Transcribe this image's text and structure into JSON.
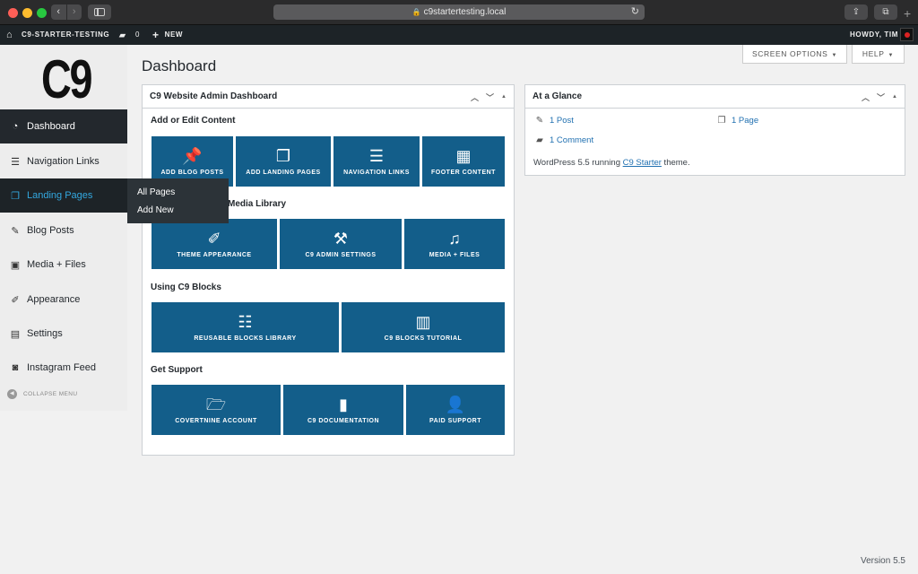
{
  "browser": {
    "url": "c9startertesting.local",
    "nav_back": "‹",
    "nav_forward": "›",
    "reload": "↻",
    "share": "⇪",
    "tabs": "⧉",
    "new_tab": "+"
  },
  "adminbar": {
    "home_icon": "⌂",
    "site_name": "C9-STARTER-TESTING",
    "comments_icon": "▰",
    "comment_count": "0",
    "new_icon": "+",
    "new_label": "NEW",
    "howdy": "HOWDY, TIM"
  },
  "sidebar": {
    "logo": "C9",
    "items": [
      {
        "label": "Dashboard",
        "icon": "◔"
      },
      {
        "label": "Navigation Links",
        "icon": "☰"
      },
      {
        "label": "Landing Pages",
        "icon": "❐"
      },
      {
        "label": "Blog Posts",
        "icon": "✎"
      },
      {
        "label": "Media + Files",
        "icon": "▣"
      },
      {
        "label": "Appearance",
        "icon": "✐"
      },
      {
        "label": "Settings",
        "icon": "▤"
      },
      {
        "label": "Instagram Feed",
        "icon": "◙"
      }
    ],
    "collapse_icon": "◀",
    "collapse_label": "COLLAPSE MENU"
  },
  "flyout": {
    "items": [
      "All Pages",
      "Add New"
    ]
  },
  "header": {
    "screen_options": "SCREEN OPTIONS",
    "help": "HELP",
    "title": "Dashboard"
  },
  "dashboard_box": {
    "title": "C9 Website Admin Dashboard",
    "ctrl_up": "︿",
    "ctrl_down": "﹀",
    "ctrl_toggle": "▲",
    "sections": [
      {
        "title": "Add or Edit Content",
        "tiles": [
          {
            "label": "ADD BLOG POSTS",
            "icon": "📌"
          },
          {
            "label": "ADD LANDING PAGES",
            "icon": "❐"
          },
          {
            "label": "NAVIGATION LINKS",
            "icon": "☰"
          },
          {
            "label": "FOOTER CONTENT",
            "icon": "▦"
          }
        ]
      },
      {
        "title": "Media Library",
        "tiles": [
          {
            "label": "THEME APPEARANCE",
            "icon": "✐"
          },
          {
            "label": "C9 ADMIN SETTINGS",
            "icon": "⚒"
          },
          {
            "label": "MEDIA + FILES",
            "icon": "♫"
          }
        ]
      },
      {
        "title": "Using C9 Blocks",
        "tiles": [
          {
            "label": "REUSABLE BLOCKS LIBRARY",
            "icon": "☷"
          },
          {
            "label": "C9 BLOCKS TUTORIAL",
            "icon": "▥"
          }
        ]
      },
      {
        "title": "Get Support",
        "tiles": [
          {
            "label": "COVERTNINE ACCOUNT",
            "icon": "🗁"
          },
          {
            "label": "C9 DOCUMENTATION",
            "icon": "▮"
          },
          {
            "label": "PAID SUPPORT",
            "icon": "👤"
          }
        ]
      }
    ]
  },
  "glance_box": {
    "title": "At a Glance",
    "posts": "1 Post",
    "pages": "1 Page",
    "comments": "1 Comment",
    "footer_prefix": "WordPress 5.5 running ",
    "theme": "C9 Starter",
    "footer_suffix": " theme."
  },
  "footer": {
    "version": "Version 5.5"
  }
}
